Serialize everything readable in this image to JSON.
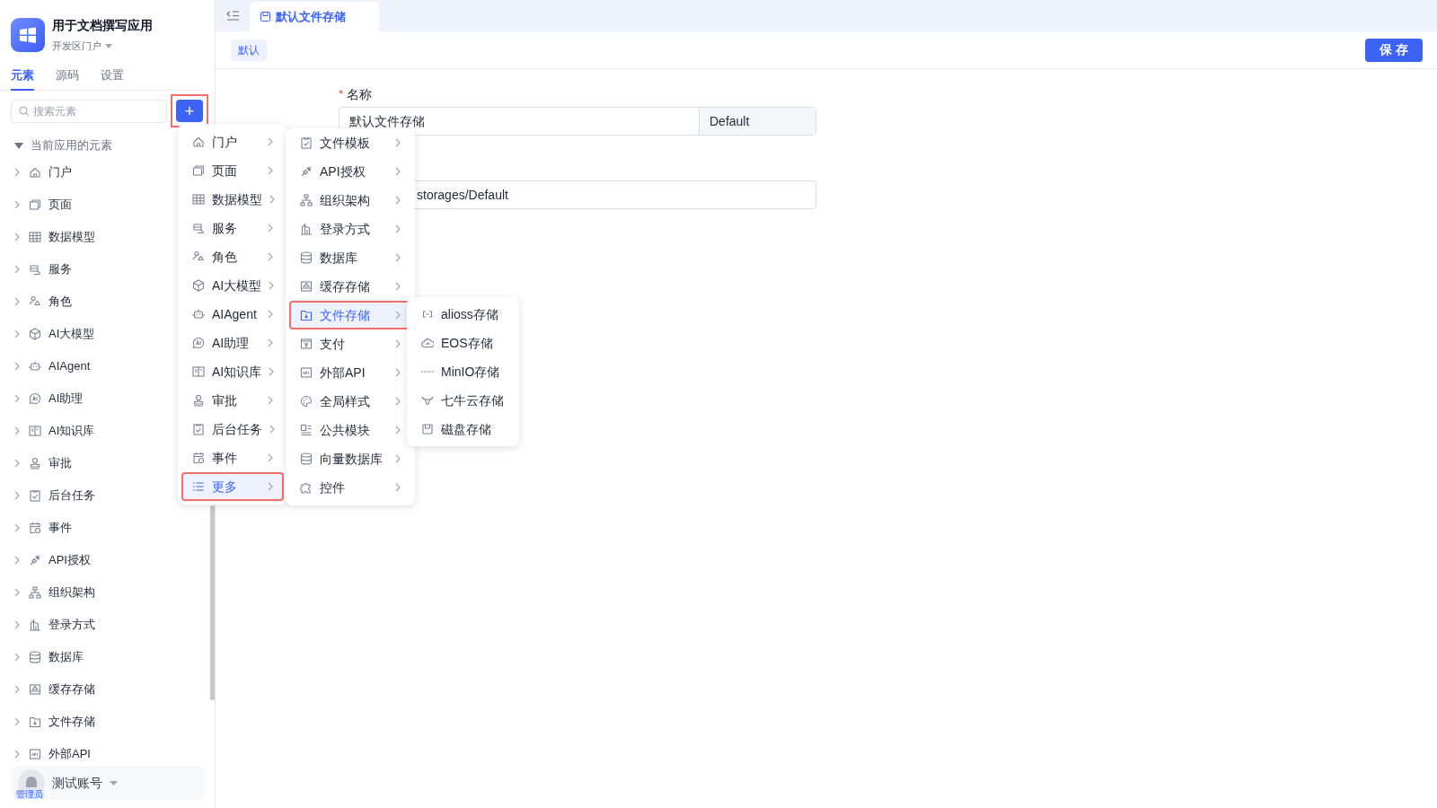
{
  "app": {
    "title": "用于文档撰写应用",
    "portal": "开发区门户"
  },
  "sidebar_tabs": [
    {
      "label": "元素",
      "selected": true
    },
    {
      "label": "源码",
      "selected": false
    },
    {
      "label": "设置",
      "selected": false
    }
  ],
  "search": {
    "placeholder": "搜索元素"
  },
  "add_button": {
    "label": "+",
    "highlighted": true
  },
  "tree": {
    "label": "当前应用的元素",
    "expanded": true,
    "children": [
      {
        "label": "门户",
        "expanded": false
      },
      {
        "label": "页面",
        "expanded": false
      },
      {
        "label": "数据模型",
        "expanded": false
      },
      {
        "label": "服务",
        "expanded": false
      },
      {
        "label": "角色",
        "expanded": false
      },
      {
        "label": "AI大模型",
        "expanded": false
      },
      {
        "label": "AIAgent",
        "expanded": false
      },
      {
        "label": "AI助理",
        "expanded": false
      },
      {
        "label": "AI知识库",
        "expanded": false
      },
      {
        "label": "审批",
        "expanded": false
      },
      {
        "label": "后台任务",
        "expanded": false
      },
      {
        "label": "事件",
        "expanded": false
      },
      {
        "label": "API授权",
        "expanded": false
      },
      {
        "label": "组织架构",
        "expanded": false
      },
      {
        "label": "登录方式",
        "expanded": false
      },
      {
        "label": "数据库",
        "expanded": false
      },
      {
        "label": "缓存存储",
        "expanded": false
      },
      {
        "label": "文件存储",
        "expanded": false
      },
      {
        "label": "外部API",
        "expanded": false
      }
    ]
  },
  "user": {
    "name": "测试账号",
    "role": "管理员"
  },
  "editor_tabs": [
    {
      "label": "默认文件存储",
      "selected": true
    }
  ],
  "toolbar": {
    "tag": "默认",
    "save_button": "保 存"
  },
  "form": {
    "name_label": "名称",
    "required_mark": "*",
    "name_value": "默认文件存储",
    "name_addon": "Default",
    "path_value": "storages/Default"
  },
  "menu_1": [
    {
      "label": "门户",
      "selected": false
    },
    {
      "label": "页面",
      "selected": false
    },
    {
      "label": "数据模型",
      "selected": false
    },
    {
      "label": "服务",
      "selected": false
    },
    {
      "label": "角色",
      "selected": false
    },
    {
      "label": "AI大模型",
      "selected": false
    },
    {
      "label": "AIAgent",
      "selected": false
    },
    {
      "label": "AI助理",
      "selected": false
    },
    {
      "label": "AI知识库",
      "selected": false
    },
    {
      "label": "审批",
      "selected": false
    },
    {
      "label": "后台任务",
      "selected": false
    },
    {
      "label": "事件",
      "selected": false
    },
    {
      "label": "更多",
      "selected": true
    }
  ],
  "menu_2": [
    {
      "label": "文件模板",
      "selected": false
    },
    {
      "label": "API授权",
      "selected": false
    },
    {
      "label": "组织架构",
      "selected": false
    },
    {
      "label": "登录方式",
      "selected": false
    },
    {
      "label": "数据库",
      "selected": false
    },
    {
      "label": "缓存存储",
      "selected": false
    },
    {
      "label": "文件存储",
      "selected": true
    },
    {
      "label": "支付",
      "selected": false
    },
    {
      "label": "外部API",
      "selected": false
    },
    {
      "label": "全局样式",
      "selected": false
    },
    {
      "label": "公共模块",
      "selected": false
    },
    {
      "label": "向量数据库",
      "selected": false
    },
    {
      "label": "控件",
      "selected": false
    }
  ],
  "menu_3": [
    {
      "label": "alioss存储"
    },
    {
      "label": "EOS存储"
    },
    {
      "label": "MinIO存储"
    },
    {
      "label": "七牛云存储"
    },
    {
      "label": "磁盘存储"
    }
  ]
}
